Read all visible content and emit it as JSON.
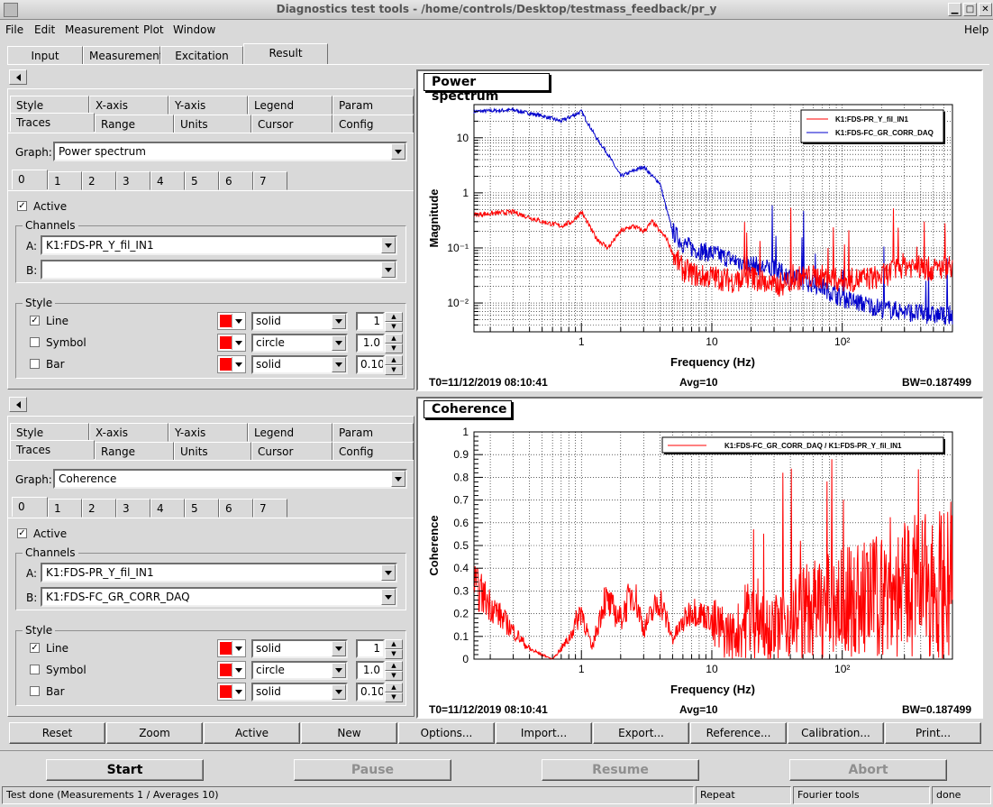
{
  "window": {
    "title": "Diagnostics test tools - /home/controls/Desktop/testmass_feedback/pr_y"
  },
  "menu": {
    "file": "File",
    "edit": "Edit",
    "measurement": "Measurement",
    "plot": "Plot",
    "window": "Window",
    "help": "Help"
  },
  "main_tabs": [
    "Input",
    "Measurement",
    "Excitation",
    "Result"
  ],
  "panels": [
    {
      "tabs_row1": [
        "Style",
        "X-axis",
        "Y-axis",
        "Legend",
        "Param"
      ],
      "tabs_row2": [
        "Traces",
        "Range",
        "Units",
        "Cursor",
        "Config"
      ],
      "graph_label": "Graph:",
      "graph_value": "Power spectrum",
      "trace_tabs": [
        "0",
        "1",
        "2",
        "3",
        "4",
        "5",
        "6",
        "7"
      ],
      "active_label": "Active",
      "channels_label": "Channels",
      "channel_a_label": "A:",
      "channel_a": "K1:FDS-PR_Y_fil_IN1",
      "channel_b_label": "B:",
      "channel_b": "",
      "style_label": "Style",
      "line_label": "Line",
      "line_style": "solid",
      "line_width": "1",
      "symbol_label": "Symbol",
      "symbol_style": "circle",
      "symbol_size": "1.0",
      "bar_label": "Bar",
      "bar_style": "solid",
      "bar_width": "0.10"
    },
    {
      "tabs_row1": [
        "Style",
        "X-axis",
        "Y-axis",
        "Legend",
        "Param"
      ],
      "tabs_row2": [
        "Traces",
        "Range",
        "Units",
        "Cursor",
        "Config"
      ],
      "graph_label": "Graph:",
      "graph_value": "Coherence",
      "trace_tabs": [
        "0",
        "1",
        "2",
        "3",
        "4",
        "5",
        "6",
        "7"
      ],
      "active_label": "Active",
      "channels_label": "Channels",
      "channel_a_label": "A:",
      "channel_a": "K1:FDS-PR_Y_fil_IN1",
      "channel_b_label": "B:",
      "channel_b": "K1:FDS-FC_GR_CORR_DAQ",
      "style_label": "Style",
      "line_label": "Line",
      "line_style": "solid",
      "line_width": "1",
      "symbol_label": "Symbol",
      "symbol_style": "circle",
      "symbol_size": "1.0",
      "bar_label": "Bar",
      "bar_style": "solid",
      "bar_width": "0.10"
    }
  ],
  "plots": [
    {
      "title": "Power spectrum",
      "ylabel": "Magnitude",
      "xlabel": "Frequency (Hz)",
      "x_ticks": [
        "1",
        "10",
        "10²"
      ],
      "y_ticks": [
        "10",
        "1",
        "10⁻¹",
        "10⁻²"
      ],
      "legend": [
        "K1:FDS-PR_Y_fil_IN1",
        "K1:FDS-FC_GR_CORR_DAQ"
      ],
      "t0": "T0=11/12/2019 08:10:41",
      "avg": "Avg=10",
      "bw": "BW=0.187499"
    },
    {
      "title": "Coherence",
      "ylabel": "Coherence",
      "xlabel": "Frequency (Hz)",
      "x_ticks": [
        "1",
        "10",
        "10²"
      ],
      "y_ticks": [
        "1",
        "0.9",
        "0.8",
        "0.7",
        "0.6",
        "0.5",
        "0.4",
        "0.3",
        "0.2",
        "0.1",
        "0"
      ],
      "legend": [
        "K1:FDS-FC_GR_CORR_DAQ / K1:FDS-PR_Y_fil_IN1"
      ],
      "t0": "T0=11/12/2019 08:10:41",
      "avg": "Avg=10",
      "bw": "BW=0.187499"
    }
  ],
  "chart_data": [
    {
      "type": "line",
      "title": "Power spectrum",
      "xlabel": "Frequency (Hz)",
      "ylabel": "Magnitude",
      "xscale": "log",
      "yscale": "log",
      "xlim": [
        0.15,
        700
      ],
      "ylim": [
        0.003,
        40
      ],
      "grid": true,
      "legend_position": "top-right",
      "series": [
        {
          "name": "K1:FDS-PR_Y_fil_IN1",
          "color": "#ff0000",
          "x": [
            0.15,
            0.3,
            0.5,
            0.7,
            0.85,
            1.0,
            1.3,
            1.6,
            2.0,
            2.5,
            3.0,
            3.5,
            4.0,
            4.5,
            5,
            6,
            7,
            8,
            10,
            15,
            20,
            30,
            50,
            70,
            100,
            200,
            300,
            500,
            700
          ],
          "y": [
            0.4,
            0.45,
            0.3,
            0.25,
            0.3,
            0.45,
            0.15,
            0.1,
            0.2,
            0.25,
            0.2,
            0.3,
            0.2,
            0.15,
            0.08,
            0.04,
            0.035,
            0.03,
            0.03,
            0.025,
            0.03,
            0.02,
            0.03,
            0.03,
            0.025,
            0.03,
            0.05,
            0.04,
            0.05
          ]
        },
        {
          "name": "K1:FDS-FC_GR_CORR_DAQ",
          "color": "#0000cc",
          "x": [
            0.15,
            0.3,
            0.5,
            0.7,
            0.85,
            1.0,
            1.3,
            1.6,
            2.0,
            2.5,
            3.0,
            3.5,
            4.0,
            4.5,
            5,
            6,
            7,
            8,
            10,
            15,
            20,
            30,
            50,
            70,
            100,
            200,
            300,
            500,
            700
          ],
          "y": [
            30,
            32,
            25,
            20,
            25,
            30,
            10,
            5,
            2,
            2.5,
            3,
            2,
            1.5,
            0.5,
            0.2,
            0.12,
            0.1,
            0.09,
            0.08,
            0.06,
            0.05,
            0.04,
            0.025,
            0.02,
            0.012,
            0.008,
            0.007,
            0.006,
            0.006
          ]
        }
      ]
    },
    {
      "type": "line",
      "title": "Coherence",
      "xlabel": "Frequency (Hz)",
      "ylabel": "Coherence",
      "xscale": "log",
      "xlim": [
        0.15,
        700
      ],
      "ylim": [
        0,
        1
      ],
      "grid": true,
      "legend_position": "top-right",
      "series": [
        {
          "name": "K1:FDS-FC_GR_CORR_DAQ / K1:FDS-PR_Y_fil_IN1",
          "color": "#ff0000",
          "x": [
            0.15,
            0.25,
            0.4,
            0.6,
            0.8,
            1.0,
            1.2,
            1.5,
            2,
            2.5,
            3,
            4,
            5,
            7,
            10,
            15,
            20,
            30,
            50,
            100,
            200,
            400,
            700
          ],
          "y": [
            0.37,
            0.2,
            0.05,
            0.0,
            0.1,
            0.25,
            0.05,
            0.3,
            0.2,
            0.35,
            0.15,
            0.3,
            0.1,
            0.25,
            0.2,
            0.15,
            0.3,
            0.2,
            0.3,
            0.35,
            0.4,
            0.45,
            0.5
          ]
        }
      ]
    }
  ],
  "bottom_buttons": [
    "Reset",
    "Zoom",
    "Active",
    "New",
    "Options...",
    "Import...",
    "Export...",
    "Reference...",
    "Calibration...",
    "Print..."
  ],
  "control_buttons": {
    "start": "Start",
    "pause": "Pause",
    "resume": "Resume",
    "abort": "Abort"
  },
  "status": {
    "main": "Test done (Measurements 1 / Averages 10)",
    "repeat": "Repeat",
    "mode": "Fourier tools",
    "state": "done"
  }
}
